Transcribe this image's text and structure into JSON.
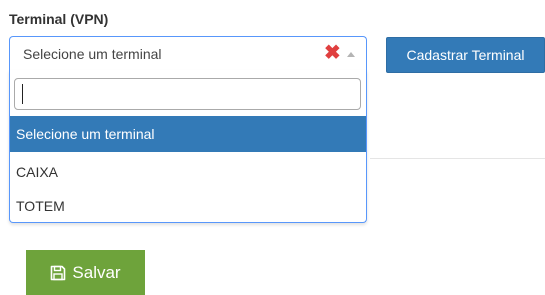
{
  "field": {
    "label": "Terminal (VPN)"
  },
  "select": {
    "selected_value": "Selecione um terminal",
    "clear_symbol": "✖",
    "search_value": ""
  },
  "dropdown": {
    "options": [
      {
        "label": "Selecione um terminal",
        "highlighted": true
      },
      {
        "label": "CAIXA",
        "highlighted": false
      },
      {
        "label": "TOTEM",
        "highlighted": false
      }
    ]
  },
  "actions": {
    "register_label": "Cadastrar Terminal",
    "save_label": "Salvar"
  },
  "colors": {
    "primary": "#337ab7",
    "success": "#6ea33b",
    "clear": "#e03f3f",
    "focus_border": "#5897fb"
  },
  "icons": {
    "clear": "close-icon",
    "arrow": "chevron-up-icon",
    "save": "floppy-disk-icon"
  }
}
